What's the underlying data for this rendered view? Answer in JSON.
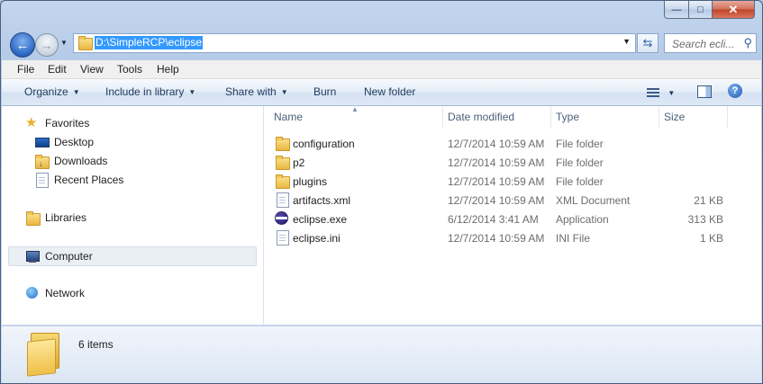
{
  "window": {
    "controls": {
      "minimize_glyph": "—",
      "maximize_glyph": "□",
      "close_glyph": "✕"
    }
  },
  "navigation": {
    "back_icon": "back-arrow-icon",
    "forward_icon": "forward-arrow-icon",
    "address_path": "D:\\SimpleRCP\\eclipse",
    "search_placeholder": "Search ecli...",
    "refresh_icon": "refresh-icon",
    "search_icon": "magnifier-icon"
  },
  "menubar": {
    "file": "File",
    "edit": "Edit",
    "view": "View",
    "tools": "Tools",
    "help": "Help"
  },
  "commandbar": {
    "organize": "Organize",
    "include_in_library": "Include in library",
    "share_with": "Share with",
    "burn": "Burn",
    "new_folder": "New folder"
  },
  "sidebar": {
    "favorites": "Favorites",
    "desktop": "Desktop",
    "downloads": "Downloads",
    "recent_places": "Recent Places",
    "libraries": "Libraries",
    "computer": "Computer",
    "network": "Network"
  },
  "columns": {
    "name": "Name",
    "date_modified": "Date modified",
    "type": "Type",
    "size": "Size"
  },
  "files": [
    {
      "name": "configuration",
      "date": "12/7/2014 10:59 AM",
      "type": "File folder",
      "size": "",
      "icon": "folder-icon"
    },
    {
      "name": "p2",
      "date": "12/7/2014 10:59 AM",
      "type": "File folder",
      "size": "",
      "icon": "folder-icon"
    },
    {
      "name": "plugins",
      "date": "12/7/2014 10:59 AM",
      "type": "File folder",
      "size": "",
      "icon": "folder-icon"
    },
    {
      "name": "artifacts.xml",
      "date": "12/7/2014 10:59 AM",
      "type": "XML Document",
      "size": "21 KB",
      "icon": "xml-file-icon"
    },
    {
      "name": "eclipse.exe",
      "date": "6/12/2014 3:41 AM",
      "type": "Application",
      "size": "313 KB",
      "icon": "eclipse-app-icon"
    },
    {
      "name": "eclipse.ini",
      "date": "12/7/2014 10:59 AM",
      "type": "INI File",
      "size": "1 KB",
      "icon": "ini-file-icon"
    }
  ],
  "status": {
    "item_count": "6 items"
  },
  "colors": {
    "selection": "#3399ff",
    "command_text": "#1e395b"
  }
}
